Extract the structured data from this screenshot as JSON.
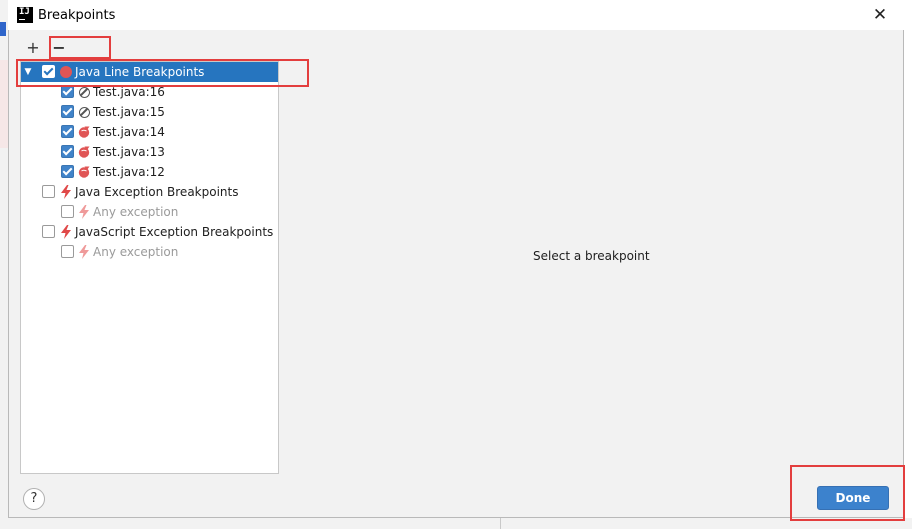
{
  "window": {
    "title": "Breakpoints",
    "close_glyph": "✕",
    "app_icon_text": "IJ"
  },
  "toolbar": {
    "add_glyph": "+",
    "remove_glyph": "−"
  },
  "tree": {
    "groups": [
      {
        "label": "Java Line Breakpoints",
        "checked": true,
        "expanded": true,
        "selected": true,
        "icon": "red-dot-icon",
        "items": [
          {
            "label": "Test.java:16",
            "checked": true,
            "icon": "muted-breakpoint-icon"
          },
          {
            "label": "Test.java:15",
            "checked": true,
            "icon": "muted-breakpoint-icon"
          },
          {
            "label": "Test.java:14",
            "checked": true,
            "icon": "conditional-breakpoint-icon"
          },
          {
            "label": "Test.java:13",
            "checked": true,
            "icon": "conditional-breakpoint-icon"
          },
          {
            "label": "Test.java:12",
            "checked": true,
            "icon": "conditional-breakpoint-icon"
          }
        ]
      },
      {
        "label": "Java Exception Breakpoints",
        "checked": false,
        "expanded": true,
        "icon": "lightning-icon",
        "items": [
          {
            "label": "Any exception",
            "checked": false,
            "icon": "lightning-icon",
            "disabled": true
          }
        ]
      },
      {
        "label": "JavaScript Exception Breakpoints",
        "checked": false,
        "expanded": true,
        "icon": "lightning-icon",
        "items": [
          {
            "label": "Any exception",
            "checked": false,
            "icon": "lightning-icon",
            "disabled": true
          }
        ]
      }
    ]
  },
  "detail": {
    "empty_text": "Select a breakpoint"
  },
  "footer": {
    "help_glyph": "?",
    "done_label": "Done"
  },
  "colors": {
    "selection": "#2675bf",
    "accent": "#3c82cd",
    "annotation": "#e33e3e",
    "breakpoint_red": "#e05555"
  }
}
